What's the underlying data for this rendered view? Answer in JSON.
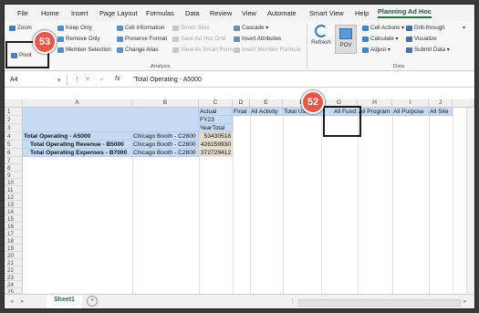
{
  "ribbon": {
    "tabs": [
      "File",
      "Home",
      "Insert",
      "Page Layout",
      "Formulas",
      "Data",
      "Review",
      "View",
      "Automate",
      "Smart View",
      "Help",
      "Planning Ad Hoc"
    ],
    "active_tab": "Planning Ad Hoc",
    "zoom_label": "Zoom",
    "pivot_label": "Pivot",
    "keep_only": "Keep Only",
    "remove_only": "Remove Only",
    "member_selection": "Member Selection",
    "cell_information": "Cell Information",
    "preserve_format": "Preserve Format",
    "change_alias": "Change Alias",
    "smart_slice": "Smart Slice",
    "save_ad_hoc_grid": "Save Ad Hoc Grid",
    "save_as_smart_form": "Save As Smart Form",
    "cascade": "Cascade",
    "insert_attributes": "Insert Attributes",
    "insert_member_formula": "Insert Member Formula",
    "analysis_group": "Analysis",
    "refresh": "Refresh",
    "pov": "POV",
    "cell_actions": "Cell Actions",
    "calculate": "Calculate",
    "adjust": "Adjust",
    "drill_through": "Drill-through",
    "visualize": "Visualize",
    "submit_data": "Submit Data",
    "data_group": "Data"
  },
  "formula_bar": {
    "name_box": "A4",
    "fx": "fx",
    "formula": "'Total Operating - A5000"
  },
  "grid": {
    "columns": [
      "A",
      "B",
      "C",
      "D",
      "E",
      "F",
      "G",
      "H",
      "I",
      "J"
    ],
    "rows": [
      "1",
      "2",
      "3",
      "4",
      "5",
      "6",
      "7",
      "8",
      "9",
      "10",
      "11",
      "12",
      "13",
      "14",
      "15",
      "16",
      "17",
      "18",
      "19",
      "20",
      "21",
      "22",
      "23",
      "24",
      "25"
    ],
    "c1": "Actual",
    "d1": "Final",
    "e1": "All Activity",
    "f1": "Total User...",
    "g1": "All Fund",
    "h1": "All Program",
    "i1": "All Purpose",
    "j1": "All Site",
    "c2": "FY23",
    "c3": "YearTotal",
    "a4": "Total Operating - A5000",
    "b4": "Chicago Booth - C2800",
    "c4": "53430518",
    "a5": "Total Operating Revenue - B5000",
    "b5": "Chicago Booth - C2800",
    "c5": "426159930",
    "a6": "Total Operating Expenses - B7000",
    "b6": "Chicago Booth - C2800",
    "c6": "372729412"
  },
  "sheet": {
    "tab": "Sheet1",
    "add": "+"
  },
  "callouts": {
    "pivot": "53",
    "all_fund": "52"
  }
}
